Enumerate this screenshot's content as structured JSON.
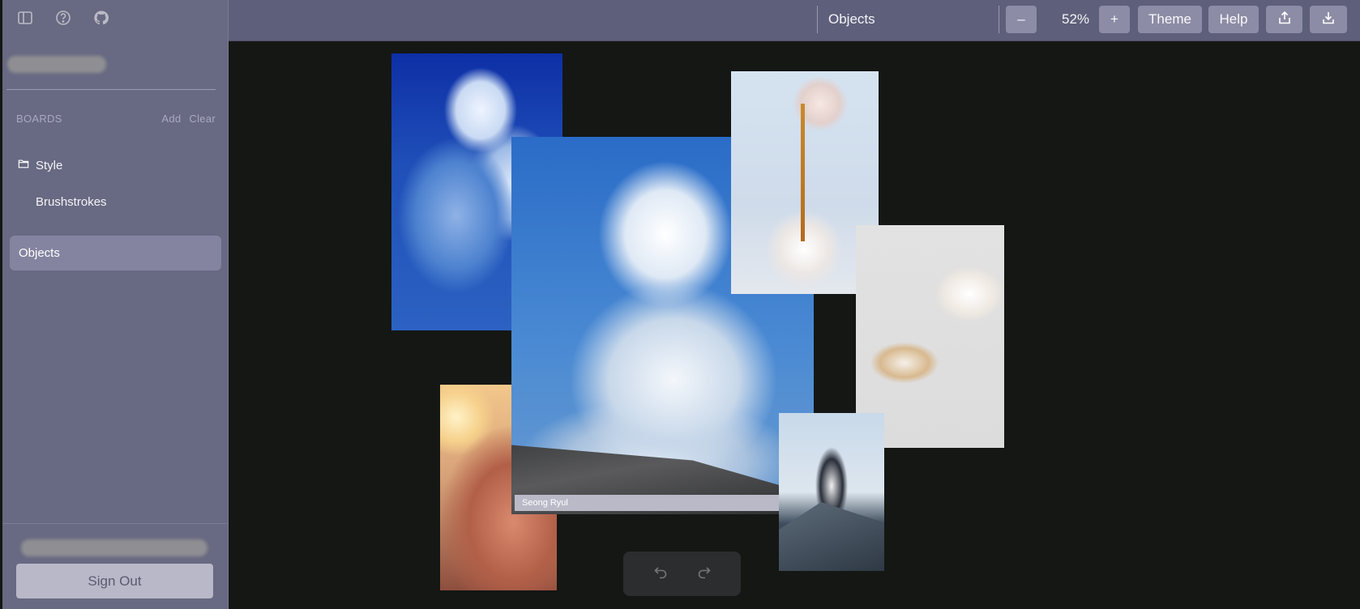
{
  "sidebar": {
    "icons": [
      "sidebar-toggle-icon",
      "help-icon",
      "github-icon"
    ],
    "boards_heading": "BOARDS",
    "add_label": "Add",
    "clear_label": "Clear",
    "items": [
      {
        "label": "Style"
      },
      {
        "label": "Brushstrokes"
      },
      {
        "label": "Objects"
      }
    ],
    "signout_label": "Sign Out"
  },
  "topbar": {
    "board_title": "Objects",
    "zoom_out_label": "–",
    "zoom_level": "52%",
    "zoom_in_label": "+",
    "theme_label": "Theme",
    "help_label": "Help"
  },
  "canvas": {
    "caption": "Seong Ryul"
  },
  "colors": {
    "sidebar_bg": "#686982",
    "topbar_bg": "#5e5f7a",
    "canvas_bg": "#141714",
    "selected_item": "#8484a0",
    "button_bg": "#8c8ca6"
  }
}
